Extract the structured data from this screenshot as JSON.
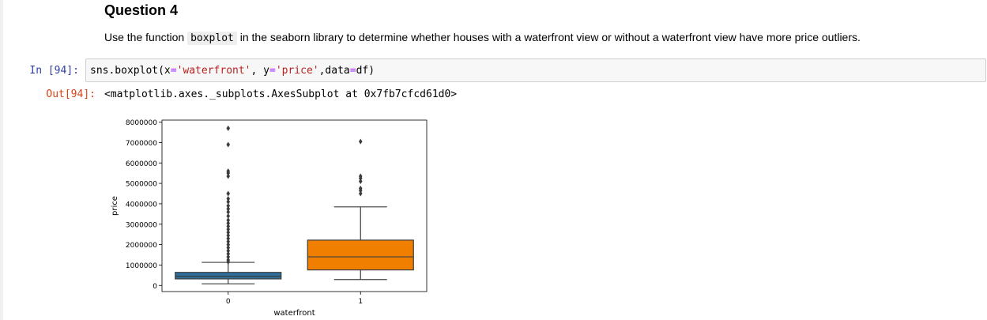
{
  "markdown": {
    "heading": "Question 4",
    "text_before": "Use the function",
    "code_inline": "boxplot",
    "text_after": "in the seaborn library to determine whether houses with a waterfront view or without a waterfront view have more price outliers."
  },
  "input_cell": {
    "prompt": "In [94]:",
    "code_parts": [
      "sns.boxplot(x",
      "=",
      "'waterfront'",
      ", y",
      "=",
      "'price'",
      ",data",
      "=",
      "df)"
    ]
  },
  "output_cell": {
    "prompt": "Out[94]:",
    "text": "<matplotlib.axes._subplots.AxesSubplot at 0x7fb7cfcd61d0>"
  },
  "chart_data": {
    "type": "box",
    "xlabel": "waterfront",
    "ylabel": "price",
    "categories": [
      "0",
      "1"
    ],
    "ylim": [
      -300000,
      8100000
    ],
    "yticks": [
      0,
      1000000,
      2000000,
      3000000,
      4000000,
      5000000,
      6000000,
      7000000,
      8000000
    ],
    "ytick_labels": [
      "0",
      "1000000",
      "2000000",
      "3000000",
      "4000000",
      "5000000",
      "6000000",
      "7000000",
      "8000000"
    ],
    "colors": [
      "#2b6f9a",
      "#f07f00"
    ],
    "boxes": [
      {
        "category": "0",
        "whisker_low": 80000,
        "q1": 320000,
        "median": 450000,
        "q3": 640000,
        "whisker_high": 1130000,
        "outliers": [
          1150000,
          1250000,
          1400000,
          1550000,
          1700000,
          1850000,
          2000000,
          2150000,
          2300000,
          2450000,
          2600000,
          2750000,
          2900000,
          3050000,
          3200000,
          3400000,
          3600000,
          3750000,
          3900000,
          4100000,
          4250000,
          4500000,
          5350000,
          5500000,
          5600000,
          6900000,
          7700000
        ]
      },
      {
        "category": "1",
        "whisker_low": 290000,
        "q1": 760000,
        "median": 1400000,
        "q3": 2220000,
        "whisker_high": 3850000,
        "outliers": [
          4500000,
          4650000,
          4750000,
          5100000,
          5250000,
          5350000,
          7050000
        ]
      }
    ]
  }
}
